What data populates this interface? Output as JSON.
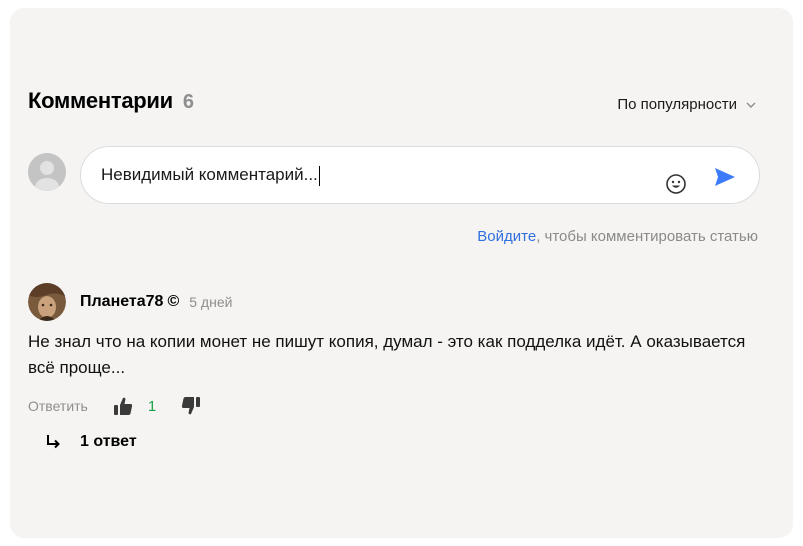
{
  "comments_section": {
    "title": "Комментарии",
    "count": "6",
    "sort_label": "По популярности"
  },
  "composer": {
    "value": "Невидимый комментарий..."
  },
  "login_prompt": {
    "link_text": "Войдите",
    "rest_text": ", чтобы комментировать статью"
  },
  "comment": {
    "author": "Планета78",
    "author_mark": "©",
    "time": "5 дней",
    "text": "Не знал что на копии монет не пишут копия, думал - это как подделка идёт. А оказывается всё проще...",
    "reply_label": "Ответить",
    "likes": "1",
    "replies_label": "1 ответ"
  },
  "colors": {
    "card_bg": "#f5f4f2",
    "link": "#2f6fe0",
    "send": "#3e7bfa",
    "likes": "#1ba34a"
  },
  "icons": [
    "chevron-down-icon",
    "user-placeholder-icon",
    "emoji-icon",
    "send-icon",
    "thumbs-up-icon",
    "thumbs-down-icon",
    "reply-arrow-icon"
  ]
}
